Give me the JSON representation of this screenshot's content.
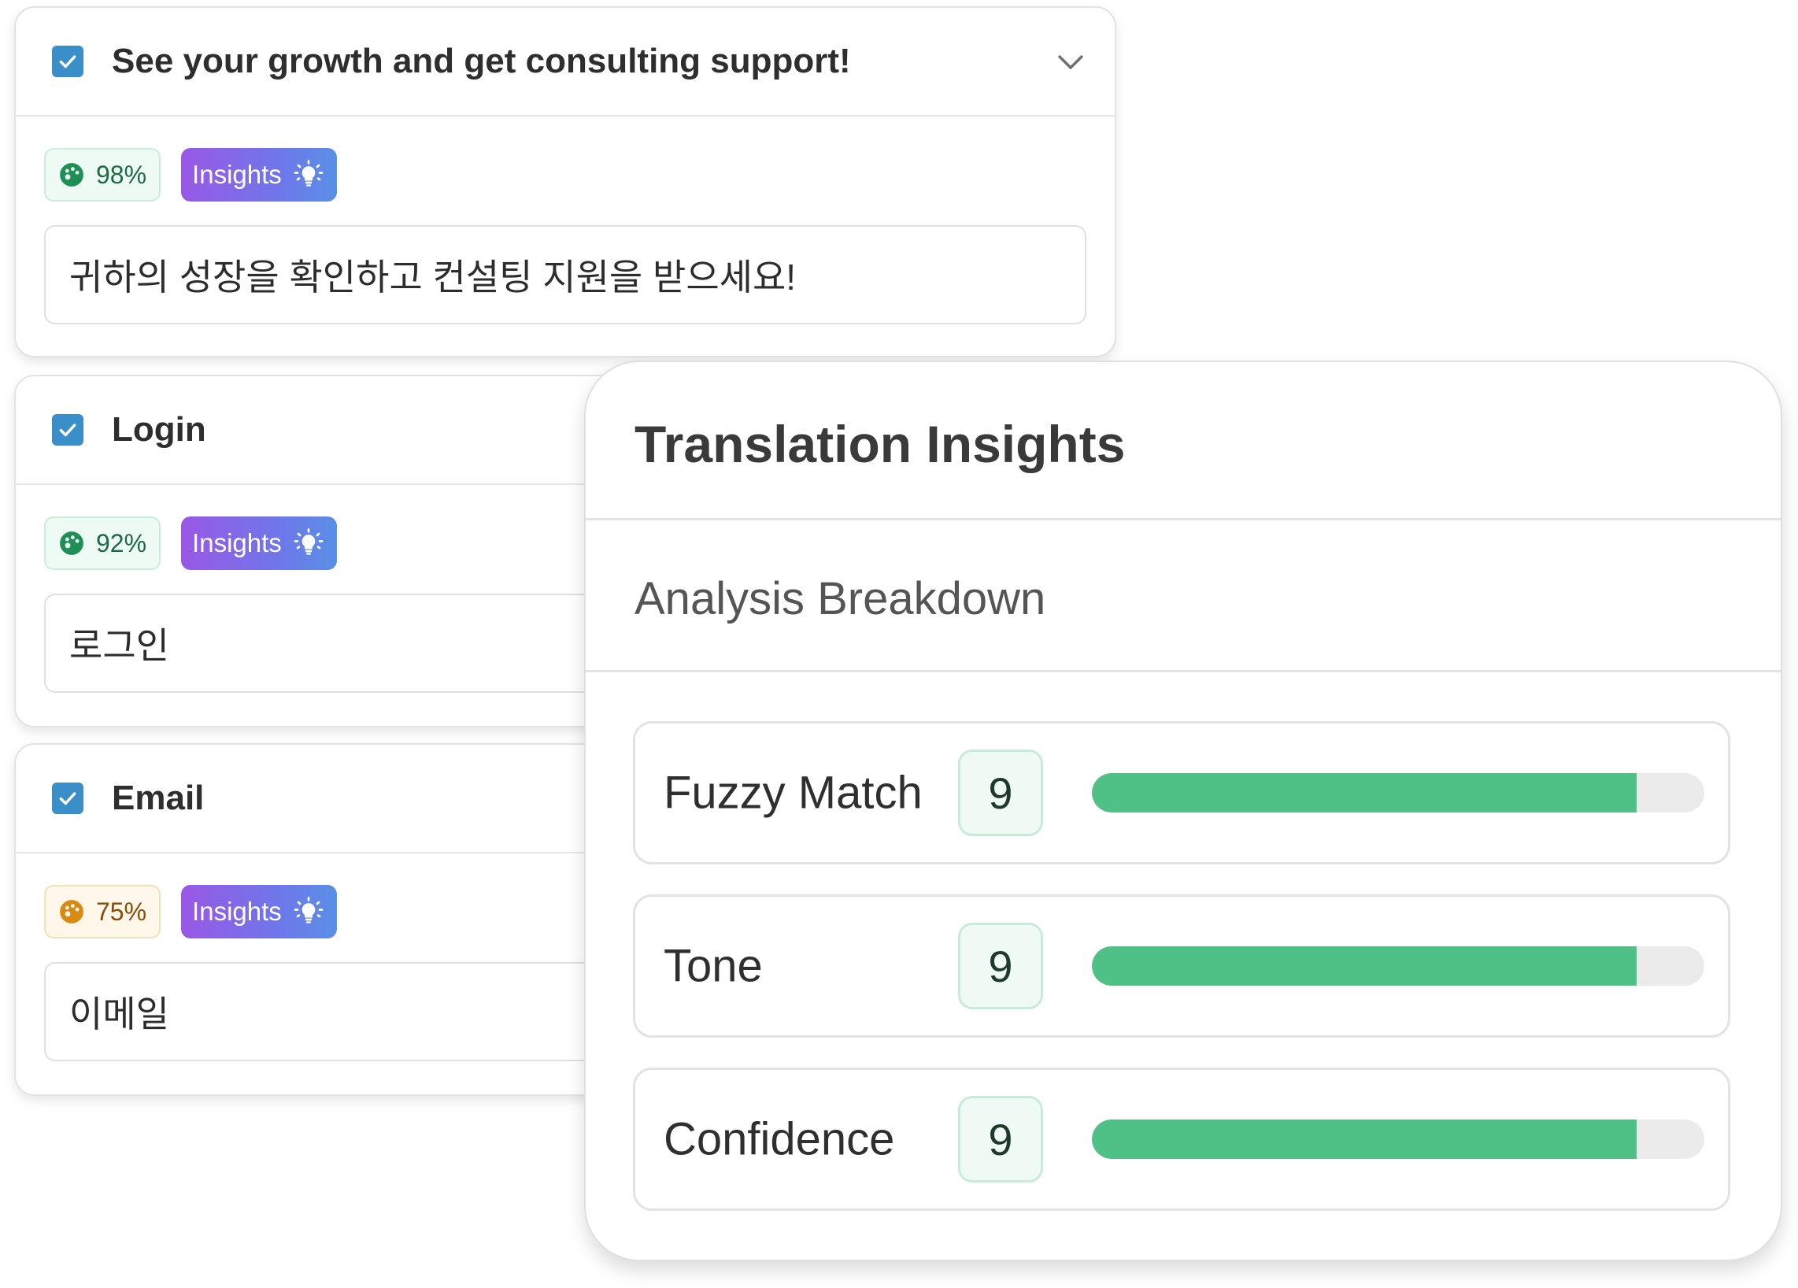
{
  "segments": [
    {
      "title": "See your growth and get consulting support!",
      "score": "98%",
      "score_level": "green",
      "insights_label": "Insights",
      "translation": "귀하의 성장을 확인하고 컨설팅 지원을 받으세요!",
      "expanded_chevron": "chevron-down-icon"
    },
    {
      "title": "Login",
      "score": "92%",
      "score_level": "green",
      "insights_label": "Insights",
      "translation": "로그인"
    },
    {
      "title": "Email",
      "score": "75%",
      "score_level": "orange",
      "insights_label": "Insights",
      "translation": "이메일"
    }
  ],
  "panel": {
    "title": "Translation Insights",
    "subtitle": "Analysis Breakdown",
    "metrics": [
      {
        "label": "Fuzzy Match",
        "score": "9",
        "fill_percent": 89
      },
      {
        "label": "Tone",
        "score": "9",
        "fill_percent": 89
      },
      {
        "label": "Confidence",
        "score": "9",
        "fill_percent": 89
      }
    ]
  },
  "colors": {
    "checkbox": "#3a8fc9",
    "score_green_text": "#1d6a44",
    "score_orange_text": "#8a4b06",
    "insights_gradient_start": "#9a58e6",
    "insights_gradient_end": "#5a8fe6",
    "bar_fill": "#4fc086",
    "bar_track": "#ebebeb"
  },
  "icons": {
    "checkbox": "check-icon",
    "score": "palette-icon",
    "insights": "lightbulb-icon"
  }
}
